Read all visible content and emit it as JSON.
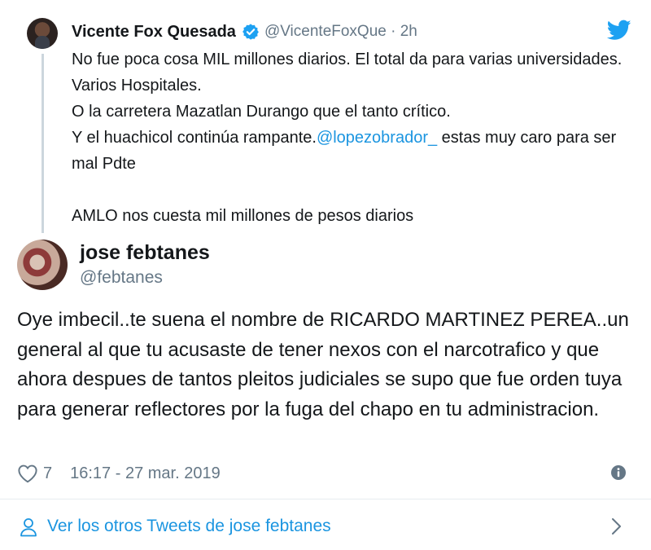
{
  "parent_tweet": {
    "name": "Vicente Fox Quesada",
    "handle_time": "@VicenteFoxQue · 2h",
    "text_before": "No fue poca cosa MIL millones diarios. El total da para varias universidades. Varios Hospitales.\nO la carretera Mazatlan Durango que el tanto crítico.\nY el huachicol continúa rampante.",
    "mention": "@lopezobrador_",
    "text_after": " estas muy caro para ser mal Pdte\n\nAMLO nos cuesta mil millones de pesos diarios",
    "verified_icon": "verified-badge-icon",
    "brand_icon": "twitter-bird-icon",
    "colors": {
      "link": "#1b95e0",
      "verified": "#1da1f2",
      "muted": "#657786"
    }
  },
  "reply_tweet": {
    "name": "jose febtanes",
    "handle": "@febtanes",
    "text": "Oye imbecil..te suena el nombre de RICARDO MARTINEZ PEREA..un general al que tu acusaste de tener nexos con el narcotrafico y que ahora despues de tantos pleitos judiciales se supo que fue orden tuya para generar reflectores por la fuga del chapo en tu administracion.",
    "likes": "7",
    "timestamp": "16:17 - 27 mar. 2019"
  },
  "footer": {
    "more_tweets_label": "Ver los otros Tweets de jose febtanes"
  }
}
